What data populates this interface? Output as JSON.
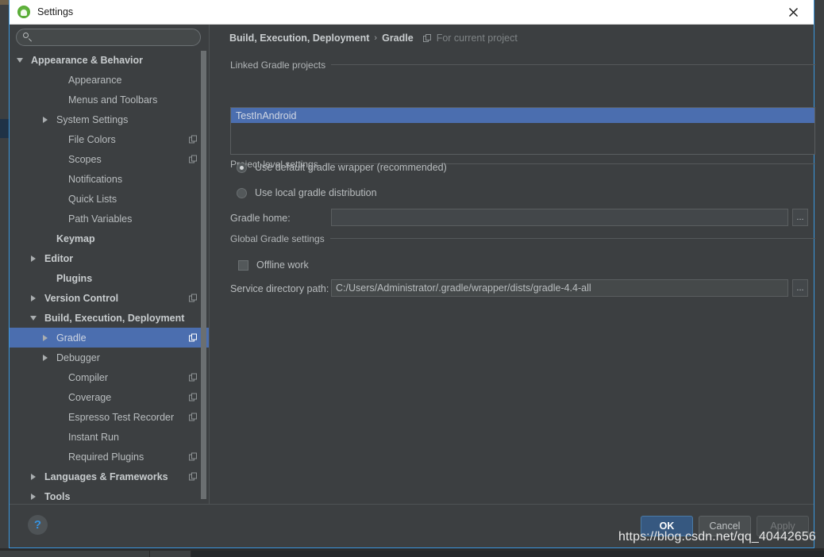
{
  "window": {
    "title": "Settings",
    "app_icon": "android-robot-icon",
    "close_icon": "close-icon"
  },
  "search": {
    "value": "",
    "placeholder": "",
    "icon": "search-icon"
  },
  "sidebar": {
    "items": [
      {
        "label": "Appearance & Behavior",
        "indent": 8,
        "twisty": "expanded",
        "bold": true,
        "badge": false,
        "selected": false
      },
      {
        "label": "Appearance",
        "indent": 55,
        "twisty": "none",
        "bold": false,
        "badge": false,
        "selected": false
      },
      {
        "label": "Menus and Toolbars",
        "indent": 55,
        "twisty": "none",
        "bold": false,
        "badge": false,
        "selected": false
      },
      {
        "label": "System Settings",
        "indent": 40,
        "twisty": "collapsed",
        "bold": false,
        "badge": false,
        "selected": false
      },
      {
        "label": "File Colors",
        "indent": 55,
        "twisty": "none",
        "bold": false,
        "badge": true,
        "selected": false
      },
      {
        "label": "Scopes",
        "indent": 55,
        "twisty": "none",
        "bold": false,
        "badge": true,
        "selected": false
      },
      {
        "label": "Notifications",
        "indent": 55,
        "twisty": "none",
        "bold": false,
        "badge": false,
        "selected": false
      },
      {
        "label": "Quick Lists",
        "indent": 55,
        "twisty": "none",
        "bold": false,
        "badge": false,
        "selected": false
      },
      {
        "label": "Path Variables",
        "indent": 55,
        "twisty": "none",
        "bold": false,
        "badge": false,
        "selected": false
      },
      {
        "label": "Keymap",
        "indent": 40,
        "twisty": "none",
        "bold": true,
        "badge": false,
        "selected": false
      },
      {
        "label": "Editor",
        "indent": 25,
        "twisty": "collapsed",
        "bold": true,
        "badge": false,
        "selected": false
      },
      {
        "label": "Plugins",
        "indent": 40,
        "twisty": "none",
        "bold": true,
        "badge": false,
        "selected": false
      },
      {
        "label": "Version Control",
        "indent": 25,
        "twisty": "collapsed",
        "bold": true,
        "badge": true,
        "selected": false
      },
      {
        "label": "Build, Execution, Deployment",
        "indent": 25,
        "twisty": "expanded",
        "bold": true,
        "badge": false,
        "selected": false
      },
      {
        "label": "Gradle",
        "indent": 40,
        "twisty": "collapsed",
        "bold": false,
        "badge": true,
        "selected": true
      },
      {
        "label": "Debugger",
        "indent": 40,
        "twisty": "collapsed",
        "bold": false,
        "badge": false,
        "selected": false
      },
      {
        "label": "Compiler",
        "indent": 55,
        "twisty": "none",
        "bold": false,
        "badge": true,
        "selected": false
      },
      {
        "label": "Coverage",
        "indent": 55,
        "twisty": "none",
        "bold": false,
        "badge": true,
        "selected": false
      },
      {
        "label": "Espresso Test Recorder",
        "indent": 55,
        "twisty": "none",
        "bold": false,
        "badge": true,
        "selected": false
      },
      {
        "label": "Instant Run",
        "indent": 55,
        "twisty": "none",
        "bold": false,
        "badge": false,
        "selected": false
      },
      {
        "label": "Required Plugins",
        "indent": 55,
        "twisty": "none",
        "bold": false,
        "badge": true,
        "selected": false
      },
      {
        "label": "Languages & Frameworks",
        "indent": 25,
        "twisty": "collapsed",
        "bold": true,
        "badge": true,
        "selected": false
      },
      {
        "label": "Tools",
        "indent": 25,
        "twisty": "collapsed",
        "bold": true,
        "badge": false,
        "selected": false
      }
    ]
  },
  "breadcrumb": {
    "parent": "Build, Execution, Deployment",
    "separator": "›",
    "current": "Gradle",
    "scope_icon": "project-scope-icon",
    "scope_note": "For current project"
  },
  "main": {
    "linked_projects": {
      "group_label": "Linked Gradle projects",
      "items": [
        "TestInAndroid"
      ],
      "selected_index": 0
    },
    "project_level": {
      "group_label": "Project-level settings",
      "radios": [
        {
          "label": "Use default gradle wrapper (recommended)",
          "checked": true
        },
        {
          "label": "Use local gradle distribution",
          "checked": false
        }
      ],
      "gradle_home": {
        "label": "Gradle home:",
        "value": "",
        "browse_label": "..."
      }
    },
    "global_settings": {
      "group_label": "Global Gradle settings",
      "offline_work": {
        "label": "Offline work",
        "checked": false
      },
      "service_directory": {
        "label": "Service directory path:",
        "value": "C:/Users/Administrator/.gradle/wrapper/dists/gradle-4.4-all",
        "browse_label": "..."
      }
    }
  },
  "footer": {
    "help_label": "?",
    "ok_label": "OK",
    "cancel_label": "Cancel",
    "apply_label": "Apply"
  },
  "overlay": {
    "watermark": "https://blog.csdn.net/qq_40442656"
  },
  "colors": {
    "accent_selection": "#4b6eaf",
    "window_border": "#3a96dd",
    "panel_bg": "#3c3f41",
    "ok_button": "#365880"
  }
}
